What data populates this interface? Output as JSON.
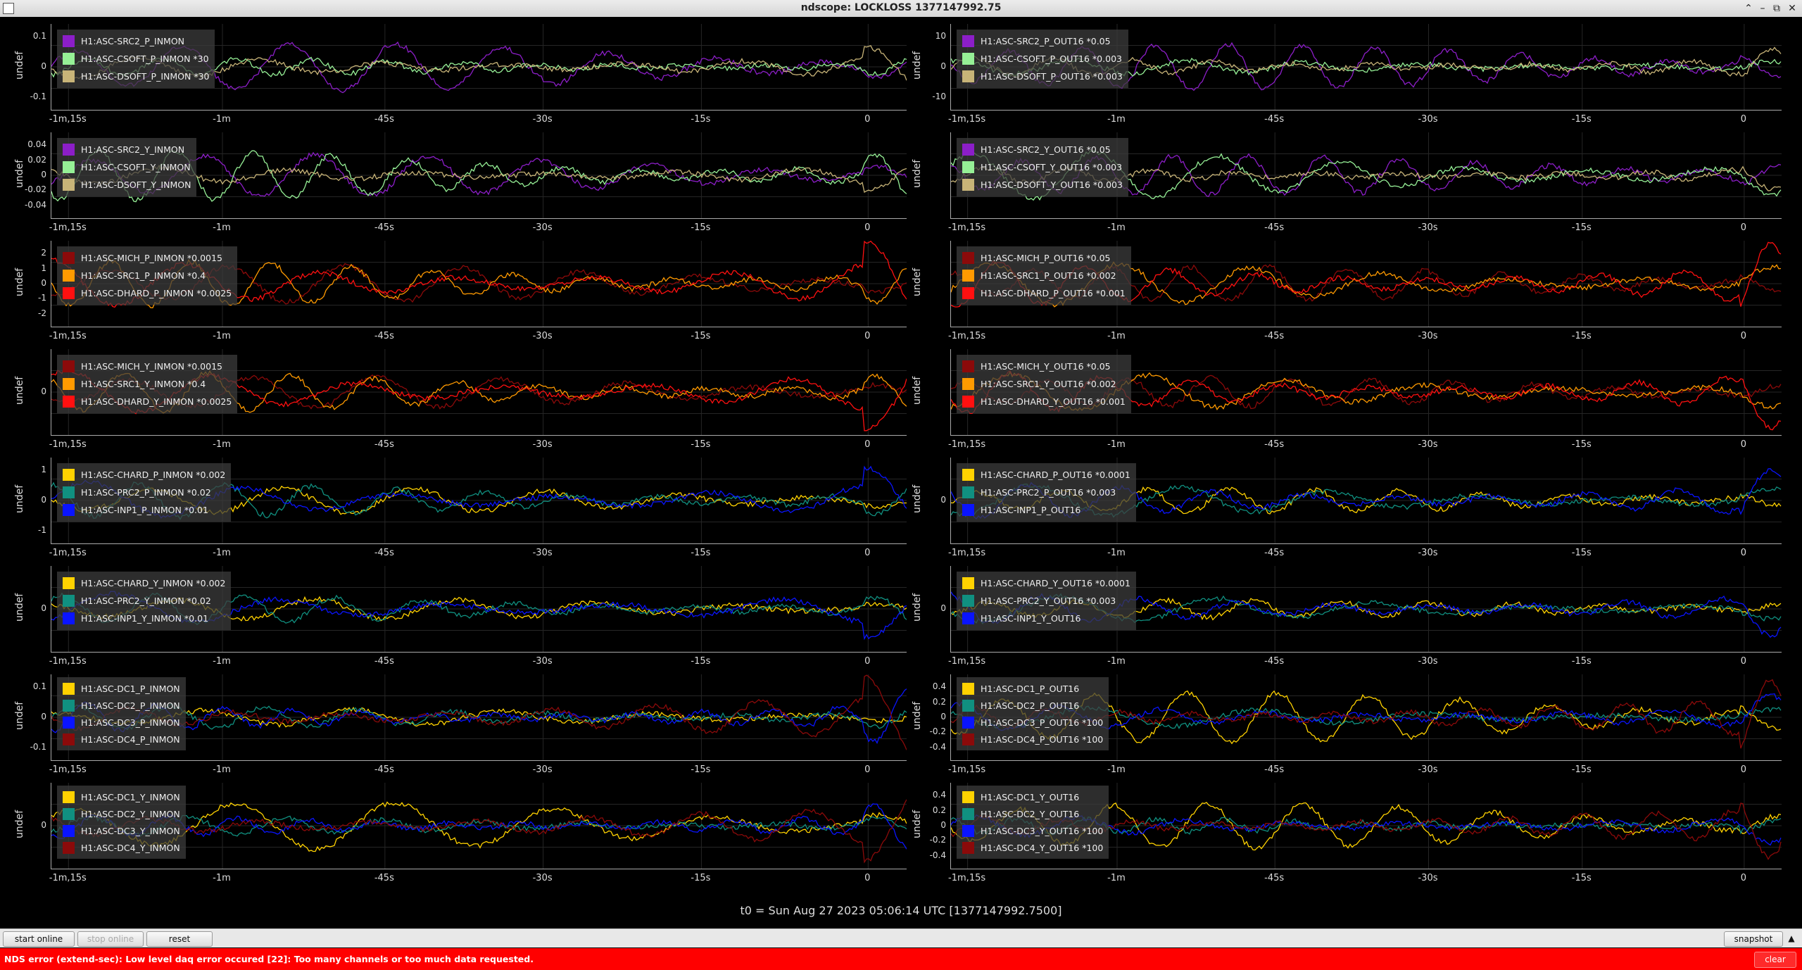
{
  "window": {
    "title": "ndscope: LOCKLOSS 1377147992.75",
    "buttons": [
      "⌃",
      "–",
      "⧉",
      "✕"
    ]
  },
  "colors": {
    "purple": "#8c1ec8",
    "lightgreen": "#96f096",
    "tan": "#c8b478",
    "darkred": "#8b0a0a",
    "orange": "#ff9a00",
    "red": "#ff1010",
    "yellow": "#ffd200",
    "teal": "#109080",
    "blue": "#0a14ff"
  },
  "x_ticks": [
    "-1m,15s",
    "-1m",
    "-45s",
    "-30s",
    "-15s",
    "0"
  ],
  "panels": [
    {
      "ylabel": "undef",
      "yticks": [
        "0.1",
        "0",
        "-0.1"
      ],
      "channels": [
        {
          "name": "H1:ASC-SRC2_P_INMON",
          "color": "purple"
        },
        {
          "name": "H1:ASC-CSOFT_P_INMON *30",
          "color": "lightgreen"
        },
        {
          "name": "H1:ASC-DSOFT_P_INMON *30",
          "color": "tan"
        }
      ]
    },
    {
      "ylabel": "undef",
      "yticks": [
        "10",
        "0",
        "-10"
      ],
      "channels": [
        {
          "name": "H1:ASC-SRC2_P_OUT16 *0.05",
          "color": "purple"
        },
        {
          "name": "H1:ASC-CSOFT_P_OUT16 *0.003",
          "color": "lightgreen"
        },
        {
          "name": "H1:ASC-DSOFT_P_OUT16 *0.003",
          "color": "tan"
        }
      ]
    },
    {
      "ylabel": "undef",
      "yticks": [
        "0.04",
        "0.02",
        "0",
        "-0.02",
        "-0.04"
      ],
      "channels": [
        {
          "name": "H1:ASC-SRC2_Y_INMON",
          "color": "purple"
        },
        {
          "name": "H1:ASC-CSOFT_Y_INMON",
          "color": "lightgreen"
        },
        {
          "name": "H1:ASC-DSOFT_Y_INMON",
          "color": "tan"
        }
      ]
    },
    {
      "ylabel": "undef",
      "yticks": [],
      "channels": [
        {
          "name": "H1:ASC-SRC2_Y_OUT16 *0.05",
          "color": "purple"
        },
        {
          "name": "H1:ASC-CSOFT_Y_OUT16 *0.003",
          "color": "lightgreen"
        },
        {
          "name": "H1:ASC-DSOFT_Y_OUT16 *0.003",
          "color": "tan"
        }
      ]
    },
    {
      "ylabel": "undef",
      "yticks": [
        "2",
        "1",
        "0",
        "-1",
        "-2"
      ],
      "channels": [
        {
          "name": "H1:ASC-MICH_P_INMON *0.0015",
          "color": "darkred"
        },
        {
          "name": "H1:ASC-SRC1_P_INMON *0.4",
          "color": "orange"
        },
        {
          "name": "H1:ASC-DHARD_P_INMON *0.0025",
          "color": "red"
        }
      ]
    },
    {
      "ylabel": "undef",
      "yticks": [],
      "channels": [
        {
          "name": "H1:ASC-MICH_P_OUT16 *0.05",
          "color": "darkred"
        },
        {
          "name": "H1:ASC-SRC1_P_OUT16 *0.002",
          "color": "orange"
        },
        {
          "name": "H1:ASC-DHARD_P_OUT16 *0.001",
          "color": "red"
        }
      ]
    },
    {
      "ylabel": "undef",
      "yticks": [
        "0"
      ],
      "channels": [
        {
          "name": "H1:ASC-MICH_Y_INMON *0.0015",
          "color": "darkred"
        },
        {
          "name": "H1:ASC-SRC1_Y_INMON *0.4",
          "color": "orange"
        },
        {
          "name": "H1:ASC-DHARD_Y_INMON *0.0025",
          "color": "red"
        }
      ]
    },
    {
      "ylabel": "undef",
      "yticks": [],
      "channels": [
        {
          "name": "H1:ASC-MICH_Y_OUT16 *0.05",
          "color": "darkred"
        },
        {
          "name": "H1:ASC-SRC1_Y_OUT16 *0.002",
          "color": "orange"
        },
        {
          "name": "H1:ASC-DHARD_Y_OUT16 *0.001",
          "color": "red"
        }
      ]
    },
    {
      "ylabel": "undef",
      "yticks": [
        "1",
        "0",
        "-1"
      ],
      "channels": [
        {
          "name": "H1:ASC-CHARD_P_INMON *0.002",
          "color": "yellow"
        },
        {
          "name": "H1:ASC-PRC2_P_INMON *0.02",
          "color": "teal"
        },
        {
          "name": "H1:ASC-INP1_P_INMON *0.01",
          "color": "blue"
        }
      ]
    },
    {
      "ylabel": "undef",
      "yticks": [
        "0"
      ],
      "channels": [
        {
          "name": "H1:ASC-CHARD_P_OUT16 *0.0001",
          "color": "yellow"
        },
        {
          "name": "H1:ASC-PRC2_P_OUT16 *0.003",
          "color": "teal"
        },
        {
          "name": "H1:ASC-INP1_P_OUT16",
          "color": "blue"
        }
      ]
    },
    {
      "ylabel": "undef",
      "yticks": [
        "0"
      ],
      "channels": [
        {
          "name": "H1:ASC-CHARD_Y_INMON *0.002",
          "color": "yellow"
        },
        {
          "name": "H1:ASC-PRC2_Y_INMON *0.02",
          "color": "teal"
        },
        {
          "name": "H1:ASC-INP1_Y_INMON *0.01",
          "color": "blue"
        }
      ]
    },
    {
      "ylabel": "undef",
      "yticks": [
        "0"
      ],
      "channels": [
        {
          "name": "H1:ASC-CHARD_Y_OUT16 *0.0001",
          "color": "yellow"
        },
        {
          "name": "H1:ASC-PRC2_Y_OUT16 *0.003",
          "color": "teal"
        },
        {
          "name": "H1:ASC-INP1_Y_OUT16",
          "color": "blue"
        }
      ]
    },
    {
      "ylabel": "undef",
      "yticks": [
        "0.1",
        "0",
        "-0.1"
      ],
      "channels": [
        {
          "name": "H1:ASC-DC1_P_INMON",
          "color": "yellow"
        },
        {
          "name": "H1:ASC-DC2_P_INMON",
          "color": "teal"
        },
        {
          "name": "H1:ASC-DC3_P_INMON",
          "color": "blue"
        },
        {
          "name": "H1:ASC-DC4_P_INMON",
          "color": "darkred"
        }
      ]
    },
    {
      "ylabel": "undef",
      "yticks": [
        "0.4",
        "0.2",
        "0",
        "-0.2",
        "-0.4"
      ],
      "channels": [
        {
          "name": "H1:ASC-DC1_P_OUT16",
          "color": "yellow"
        },
        {
          "name": "H1:ASC-DC2_P_OUT16",
          "color": "teal"
        },
        {
          "name": "H1:ASC-DC3_P_OUT16 *100",
          "color": "blue"
        },
        {
          "name": "H1:ASC-DC4_P_OUT16 *100",
          "color": "darkred"
        }
      ]
    },
    {
      "ylabel": "undef",
      "yticks": [
        "0"
      ],
      "channels": [
        {
          "name": "H1:ASC-DC1_Y_INMON",
          "color": "yellow"
        },
        {
          "name": "H1:ASC-DC2_Y_INMON",
          "color": "teal"
        },
        {
          "name": "H1:ASC-DC3_Y_INMON",
          "color": "blue"
        },
        {
          "name": "H1:ASC-DC4_Y_INMON",
          "color": "darkred"
        }
      ]
    },
    {
      "ylabel": "undef",
      "yticks": [
        "0.4",
        "0.2",
        "0",
        "-0.2",
        "-0.4"
      ],
      "channels": [
        {
          "name": "H1:ASC-DC1_Y_OUT16",
          "color": "yellow"
        },
        {
          "name": "H1:ASC-DC2_Y_OUT16",
          "color": "teal"
        },
        {
          "name": "H1:ASC-DC3_Y_OUT16 *100",
          "color": "blue"
        },
        {
          "name": "H1:ASC-DC4_Y_OUT16 *100",
          "color": "darkred"
        }
      ]
    }
  ],
  "t0_label": "t0 = Sun Aug 27 2023 05:06:14 UTC [1377147992.7500]",
  "toolbar": {
    "start_online": "start online",
    "stop_online": "stop online",
    "reset": "reset",
    "snapshot": "snapshot",
    "arrow": "▲"
  },
  "error": {
    "message": "NDS error (extend-sec): Low level daq error occured [22]: Too many channels or too much data requested.",
    "clear": "clear"
  }
}
